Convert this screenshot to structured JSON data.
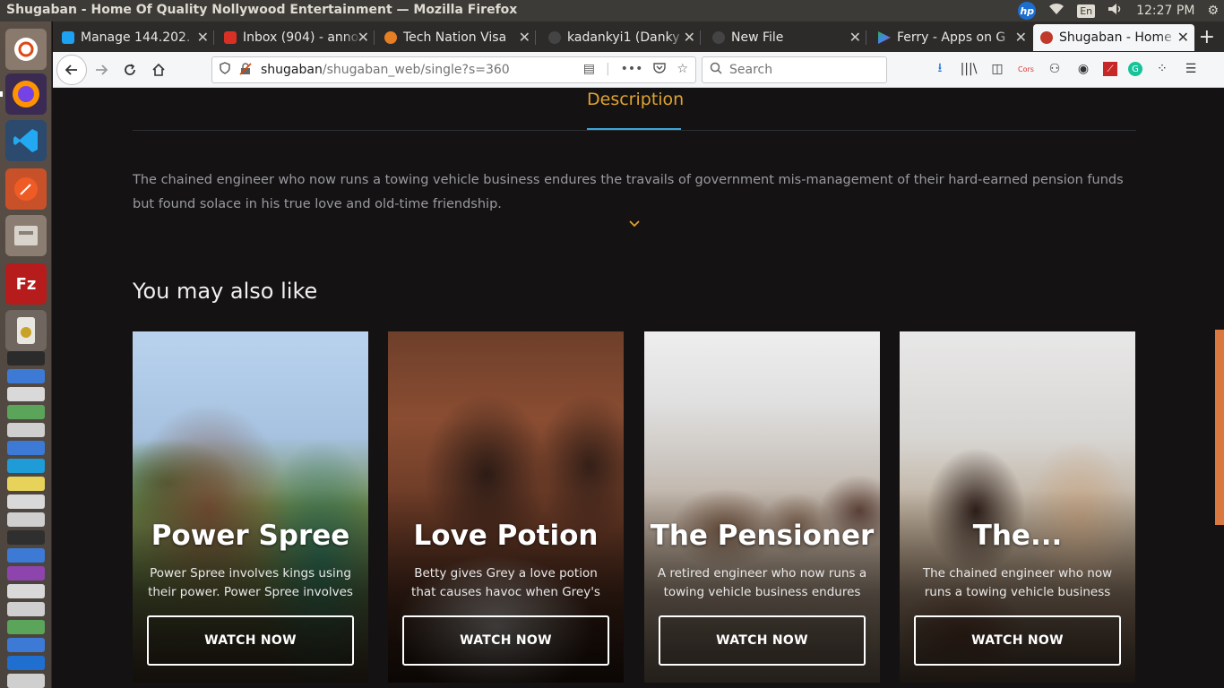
{
  "window_title": "Shugaban - Home Of Quality Nollywood Entertainment — Mozilla Firefox",
  "tray": {
    "lang": "En",
    "clock": "12:27 PM"
  },
  "tabs": [
    {
      "label": "Manage 144.202.",
      "color": "#1da1f2"
    },
    {
      "label": "Inbox (904) - anno",
      "color": "#d93025"
    },
    {
      "label": "Tech Nation Visa",
      "color": "#e67e22"
    },
    {
      "label": "kadankyi1 (Danky",
      "color": "#444444"
    },
    {
      "label": "New File",
      "color": "#444444"
    },
    {
      "label": "Ferry - Apps on G",
      "color": "#34a853"
    },
    {
      "label": "Shugaban - Home",
      "color": "#c0392b"
    }
  ],
  "url": {
    "host": "shugaban",
    "path": "/shugaban_web/single?s=360"
  },
  "search": {
    "placeholder": "Search"
  },
  "page": {
    "desc_tab": "Description",
    "description": "The chained engineer who now runs a towing vehicle business endures the travails of government mis-management of their hard-earned pension funds but found solace in his true love and old-time friendship.",
    "section_title": "You may also like",
    "cards": [
      {
        "title": "Power Spree",
        "desc": "Power Spree involves kings using their power. Power Spree involves",
        "button": "WATCH NOW"
      },
      {
        "title": "Love Potion",
        "desc": "Betty gives Grey a love potion that causes havoc when Grey's mum",
        "button": "WATCH NOW"
      },
      {
        "title": "The Pensioner",
        "desc": "A retired engineer who now runs a towing vehicle business endures",
        "button": "WATCH NOW"
      },
      {
        "title": "The...",
        "desc": "The chained engineer who now runs a towing vehicle business",
        "button": "WATCH NOW"
      }
    ]
  },
  "colors": {
    "accent": "#e0a32e",
    "tab_underline": "#3ba7d9",
    "scroll_thumb": "#d9793f"
  }
}
